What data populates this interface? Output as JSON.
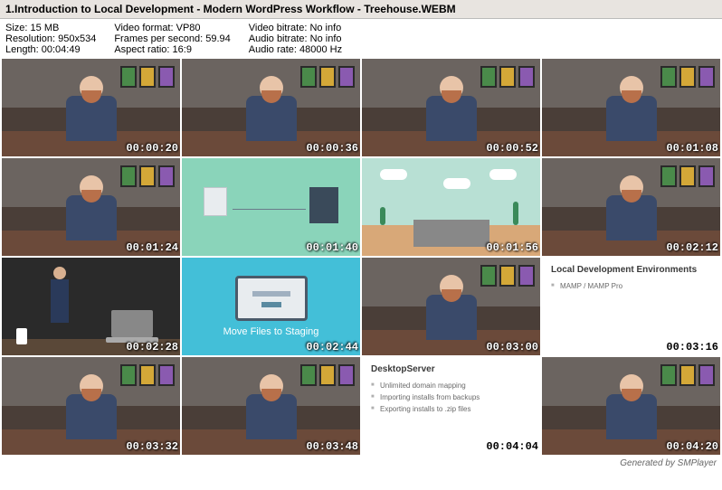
{
  "file": {
    "title": "1.Introduction to Local Development - Modern WordPress Workflow - Treehouse.WEBM"
  },
  "meta": {
    "size_label": "Size:",
    "size": "15 MB",
    "res_label": "Resolution:",
    "res": "950x534",
    "len_label": "Length:",
    "len": "00:04:49",
    "vfmt_label": "Video format:",
    "vfmt": "VP80",
    "fps_label": "Frames per second:",
    "fps": "59.94",
    "ar_label": "Aspect ratio:",
    "ar": "16:9",
    "vbr_label": "Video bitrate:",
    "vbr": "No info",
    "abr_label": "Audio bitrate:",
    "abr": "No info",
    "arate_label": "Audio rate:",
    "arate": "48000 Hz"
  },
  "timestamps": [
    "00:00:20",
    "00:00:36",
    "00:00:52",
    "00:01:08",
    "00:01:24",
    "00:01:40",
    "00:01:56",
    "00:02:12",
    "00:02:28",
    "00:02:44",
    "00:03:00",
    "00:03:16",
    "00:03:32",
    "00:03:48",
    "00:04:04",
    "00:04:20"
  ],
  "staging_label": "Move Files to Staging",
  "slide1": {
    "title": "Local Development Environments",
    "items": [
      "MAMP / MAMP Pro"
    ]
  },
  "slide2": {
    "title": "DesktopServer",
    "items": [
      "Unlimited domain mapping",
      "Importing installs from backups",
      "Exporting installs to .zip files"
    ]
  },
  "footer": "Generated by SMPlayer"
}
